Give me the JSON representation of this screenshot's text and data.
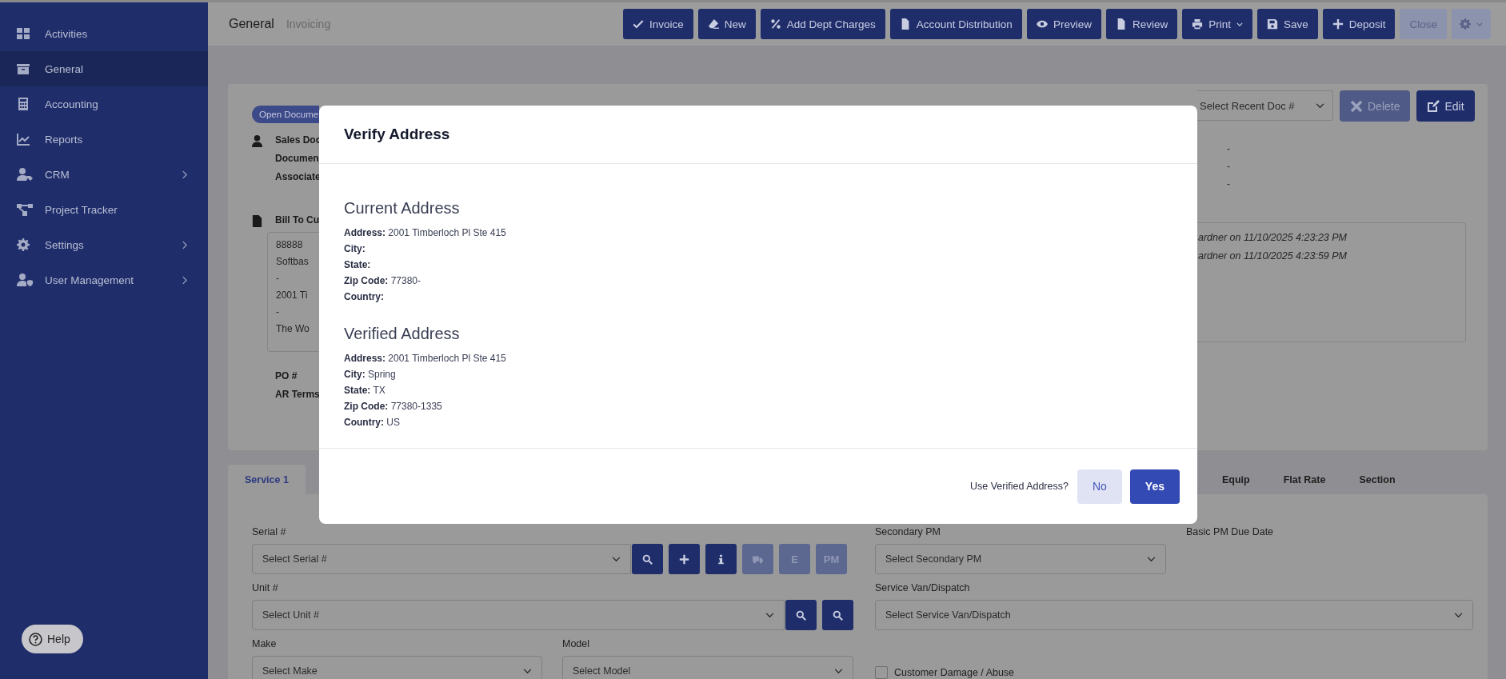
{
  "sidebar": {
    "items": [
      {
        "label": "Activities",
        "selected": false,
        "expandable": false
      },
      {
        "label": "General",
        "selected": true,
        "expandable": false
      },
      {
        "label": "Accounting",
        "selected": false,
        "expandable": false
      },
      {
        "label": "Reports",
        "selected": false,
        "expandable": false
      },
      {
        "label": "CRM",
        "selected": false,
        "expandable": true
      },
      {
        "label": "Project Tracker",
        "selected": false,
        "expandable": false
      },
      {
        "label": "Settings",
        "selected": false,
        "expandable": true
      },
      {
        "label": "User Management",
        "selected": false,
        "expandable": true
      }
    ],
    "help": "Help"
  },
  "header": {
    "title": "General",
    "subtitle": "Invoicing"
  },
  "toolbar": [
    {
      "label": "Invoice",
      "disabled": false,
      "caret": false
    },
    {
      "label": "New",
      "disabled": false,
      "caret": false
    },
    {
      "label": "Add Dept Charges",
      "disabled": false,
      "caret": false
    },
    {
      "label": "Account Distribution",
      "disabled": false,
      "caret": false
    },
    {
      "label": "Preview",
      "disabled": false,
      "caret": false
    },
    {
      "label": "Review",
      "disabled": false,
      "caret": false
    },
    {
      "label": "Print",
      "disabled": false,
      "caret": true
    },
    {
      "label": "Save",
      "disabled": false,
      "caret": false
    },
    {
      "label": "Deposit",
      "disabled": false,
      "caret": false
    },
    {
      "label": "Close",
      "disabled": true,
      "caret": false
    }
  ],
  "settings_menu": {
    "disabled": true,
    "caret": true
  },
  "document": {
    "status_badge": "Open Docume",
    "labels": [
      "Sales Doc",
      "Documen",
      "Associate"
    ],
    "values": [
      "-",
      "-",
      "-"
    ],
    "bill_to_label": "Bill To Cu",
    "address_lines": [
      "88888",
      "Softbas",
      "-",
      "2001 Ti",
      "-",
      "The Wo"
    ],
    "notes": [
      "ardner on 11/10/2025 4:23:23 PM",
      "ardner on 11/10/2025 4:23:59 PM"
    ],
    "po_label": "PO #",
    "ar_terms_label": "AR Terms",
    "recent_doc": {
      "placeholder": "Select Recent Doc #"
    },
    "actions": [
      {
        "label": "Delete",
        "disabled": true
      },
      {
        "label": "Edit",
        "disabled": false
      }
    ]
  },
  "tabs": [
    {
      "label": "Service 1",
      "selected": true
    },
    {
      "label": "Equip",
      "selected": false
    },
    {
      "label": "Flat Rate",
      "selected": false
    },
    {
      "label": "Section",
      "selected": false
    }
  ],
  "form": {
    "serial": {
      "label": "Serial #",
      "placeholder": "Select Serial #",
      "buttons": [
        {
          "disabled": false
        },
        {
          "disabled": false
        },
        {
          "disabled": false
        },
        {
          "disabled": true
        },
        {
          "label": "E",
          "disabled": true
        },
        {
          "label": "PM",
          "disabled": true
        }
      ]
    },
    "secondary_pm": {
      "label": "Secondary PM",
      "placeholder": "Select Secondary PM"
    },
    "basic_pm_due_date": {
      "label": "Basic PM Due Date"
    },
    "unit": {
      "label": "Unit #",
      "placeholder": "Select Unit #",
      "buttons": [
        {
          "disabled": false
        },
        {
          "disabled": false
        }
      ]
    },
    "service_van": {
      "label": "Service Van/Dispatch",
      "placeholder": "Select Service Van/Dispatch"
    },
    "make": {
      "label": "Make",
      "placeholder": "Select Make"
    },
    "model": {
      "label": "Model",
      "placeholder": "Select Model"
    },
    "customer_damage": {
      "label": "Customer Damage / Abuse",
      "checked": false
    }
  },
  "modal": {
    "title": "Verify Address",
    "sections": [
      {
        "heading": "Current Address",
        "fields": [
          {
            "label": "Address:",
            "value": "2001 Timberloch Pl Ste 415"
          },
          {
            "label": "City:"
          },
          {
            "label": "State:"
          },
          {
            "label": "Zip Code:",
            "value": "77380-"
          },
          {
            "label": "Country:"
          }
        ]
      },
      {
        "heading": "Verified Address",
        "fields": [
          {
            "label": "Address:",
            "value": "2001 Timberloch Pl Ste 415"
          },
          {
            "label": "City:",
            "value": "Spring"
          },
          {
            "label": "State:",
            "value": "TX"
          },
          {
            "label": "Zip Code:",
            "value": "77380-1335"
          },
          {
            "label": "Country:",
            "value": "US"
          }
        ]
      }
    ],
    "question": "Use Verified Address?",
    "buttons": [
      {
        "label": "No",
        "kind": "secondary"
      },
      {
        "label": "Yes",
        "kind": "primary"
      }
    ]
  }
}
